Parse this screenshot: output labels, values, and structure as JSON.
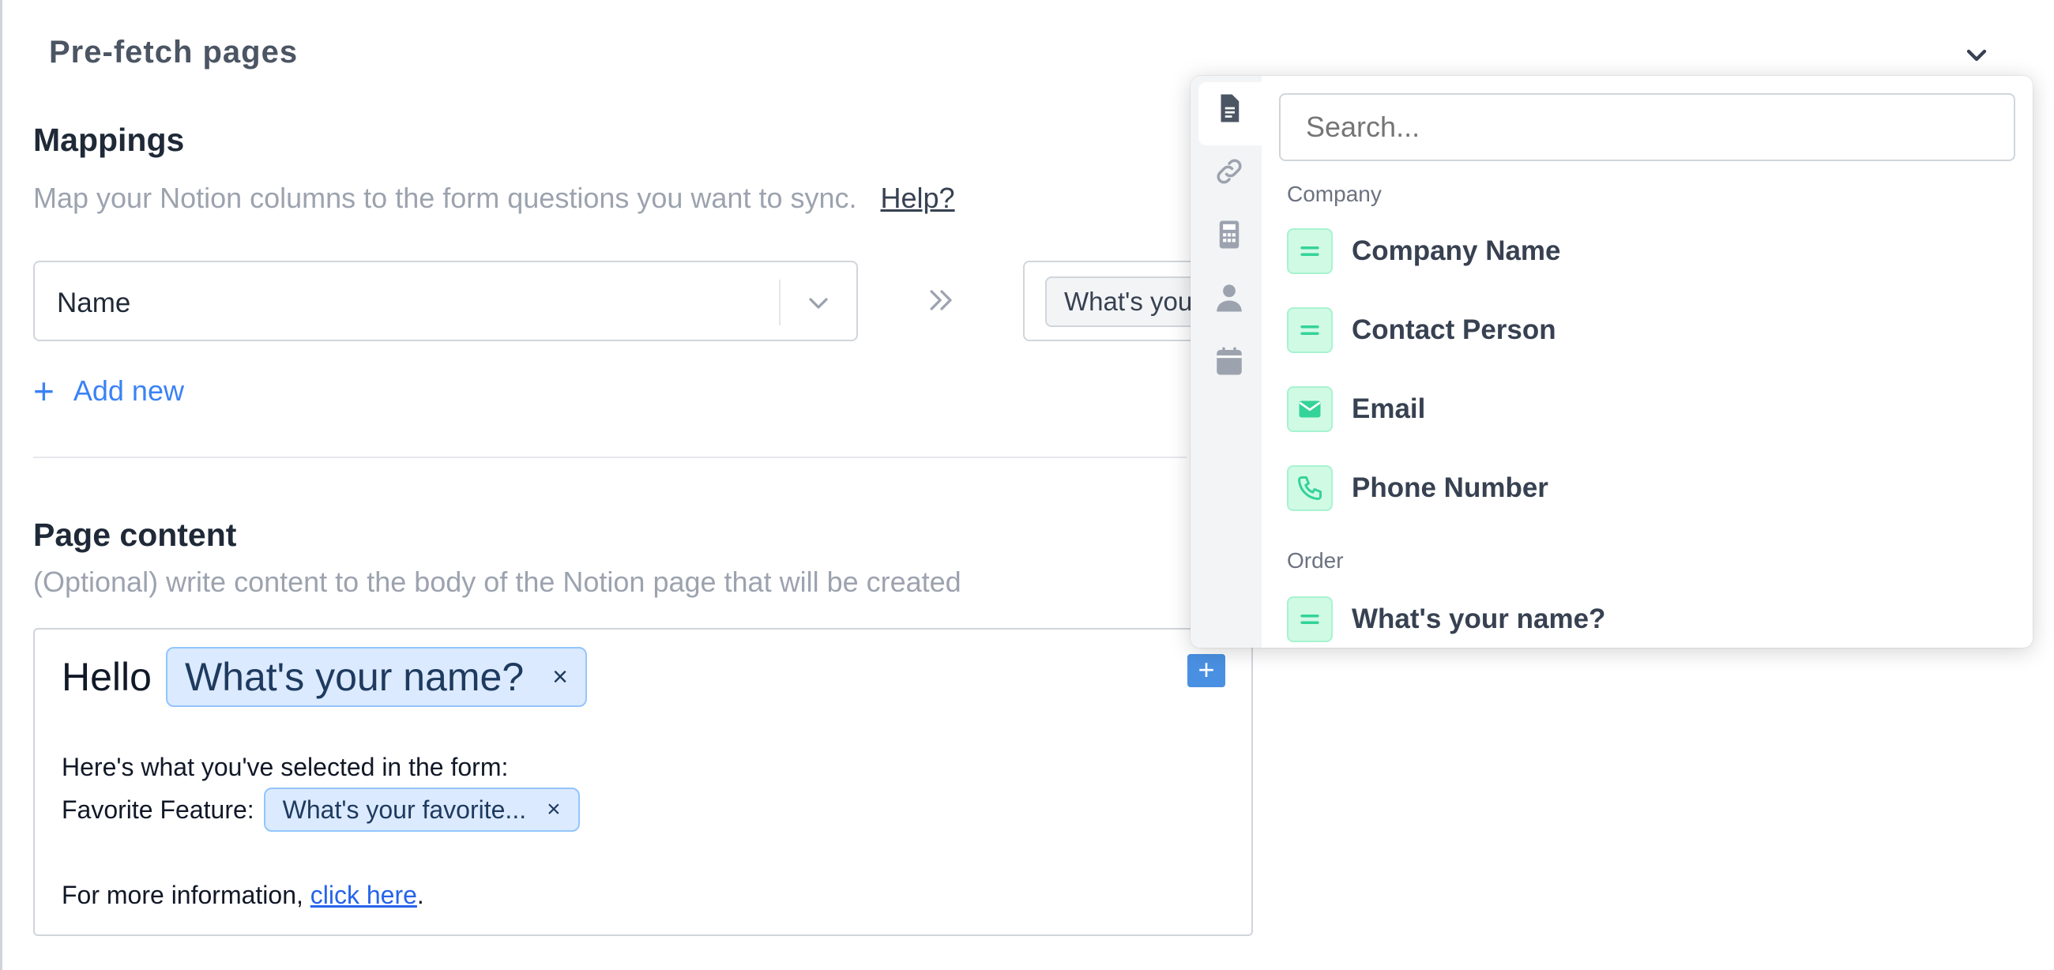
{
  "prefetch": {
    "title": "Pre-fetch pages"
  },
  "mappings": {
    "title": "Mappings",
    "description": "Map your Notion columns to the form questions you want to sync.",
    "help_link": "Help?",
    "row": {
      "source_value": "Name",
      "target_tag": "What's your"
    },
    "add_new_label": "Add new"
  },
  "page_content": {
    "title": "Page content",
    "description": "(Optional) write content to the body of the Notion page that will be created",
    "editor": {
      "hello": "Hello",
      "hello_chip": "What's your name?",
      "line1": "Here's what you've selected in the form:",
      "fav_label": "Favorite Feature:",
      "fav_chip": "What's your favorite...",
      "more_prefix": "For more information, ",
      "more_link": "click here",
      "more_suffix": ".",
      "chip_remove": "×",
      "insert_button": "+"
    }
  },
  "popover": {
    "search_placeholder": "Search...",
    "rail_icons": [
      "document-icon",
      "link-icon",
      "calculator-icon",
      "person-icon",
      "calendar-icon"
    ],
    "groups": [
      {
        "label": "Company",
        "items": [
          {
            "label": "Company Name",
            "icon": "text-lines-icon"
          },
          {
            "label": "Contact Person",
            "icon": "text-lines-icon"
          },
          {
            "label": "Email",
            "icon": "envelope-icon"
          },
          {
            "label": "Phone Number",
            "icon": "phone-icon"
          }
        ]
      },
      {
        "label": "Order",
        "items": [
          {
            "label": "What's your name?",
            "icon": "text-lines-icon"
          }
        ]
      }
    ]
  },
  "colors": {
    "accent": "#3b82f6",
    "chip_bg": "#dbeafe",
    "item_icon_bg": "#d1fae5",
    "item_icon_fg": "#34d399"
  }
}
